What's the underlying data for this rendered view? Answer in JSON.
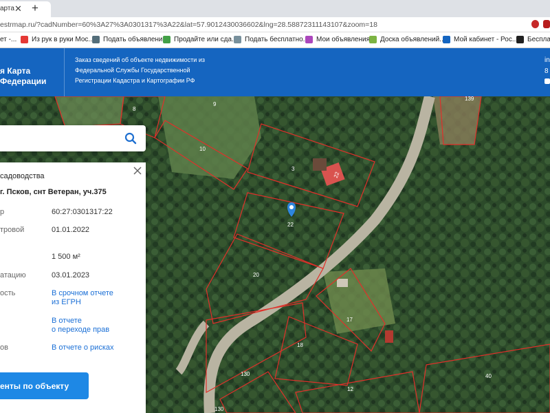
{
  "browser": {
    "tab_title": "арта",
    "url": "estrmap.ru/?cadNumber=60%3A27%3A0301317%3A22&lat=57.9012430036602&lng=28.58872311143107&zoom=18",
    "bookmarks": [
      {
        "label": "ет -...",
        "icon": "globe-icon",
        "color": "#9e9e9e"
      },
      {
        "label": "Из рук в руки Мос...",
        "icon": "irr-icon",
        "color": "#e53935"
      },
      {
        "label": "Подать объявление",
        "icon": "page-icon",
        "color": "#546e7a"
      },
      {
        "label": "Продайте или сда...",
        "icon": "circle-icon",
        "color": "#43a047"
      },
      {
        "label": "Подать бесплатно...",
        "icon": "gear-icon",
        "color": "#78909c"
      },
      {
        "label": "Мои объявления",
        "icon": "avito-icon",
        "color": "#ab47bc"
      },
      {
        "label": "Доска объявлений...",
        "icon": "board-icon",
        "color": "#7cb342"
      },
      {
        "label": "Мой кабинет - Рос...",
        "icon": "flag-icon",
        "color": "#1565c0"
      },
      {
        "label": "Бесплатн",
        "icon": "doc-icon",
        "color": "#212121"
      }
    ]
  },
  "header": {
    "logo_line1": "я Карта",
    "logo_line2": "Федерации",
    "info_text": "Заказ сведений об объекте недвижимости из Федеральной Службы Государственной Регистрации Кадастра и Картографии РФ",
    "right_line1": "in",
    "right_line2": "8"
  },
  "map": {
    "parcel_labels": [
      "8",
      "9",
      "139",
      "10",
      "3",
      "22",
      "20",
      "17",
      "18",
      "130",
      "12",
      "40",
      "130"
    ],
    "marker_label": "22"
  },
  "search": {
    "placeholder": ""
  },
  "panel": {
    "category": "садоводства",
    "address": "г. Псков, снт Ветеран, уч.375",
    "rows": [
      {
        "label": "р",
        "value": "60:27:0301317:22"
      },
      {
        "label": "тровой",
        "value": "01.01.2022"
      },
      {
        "label": "",
        "value": "1 500 м²"
      },
      {
        "label": "атацию",
        "value": "03.01.2023"
      }
    ],
    "links": [
      {
        "label": "ость",
        "value": "В срочном отчете\nиз ЕГРН"
      },
      {
        "label": "",
        "value": "В отчете\nо переходе прав"
      },
      {
        "label": "ов",
        "value": "В отчете о рисках"
      }
    ],
    "report_button": "енты по объекту"
  }
}
